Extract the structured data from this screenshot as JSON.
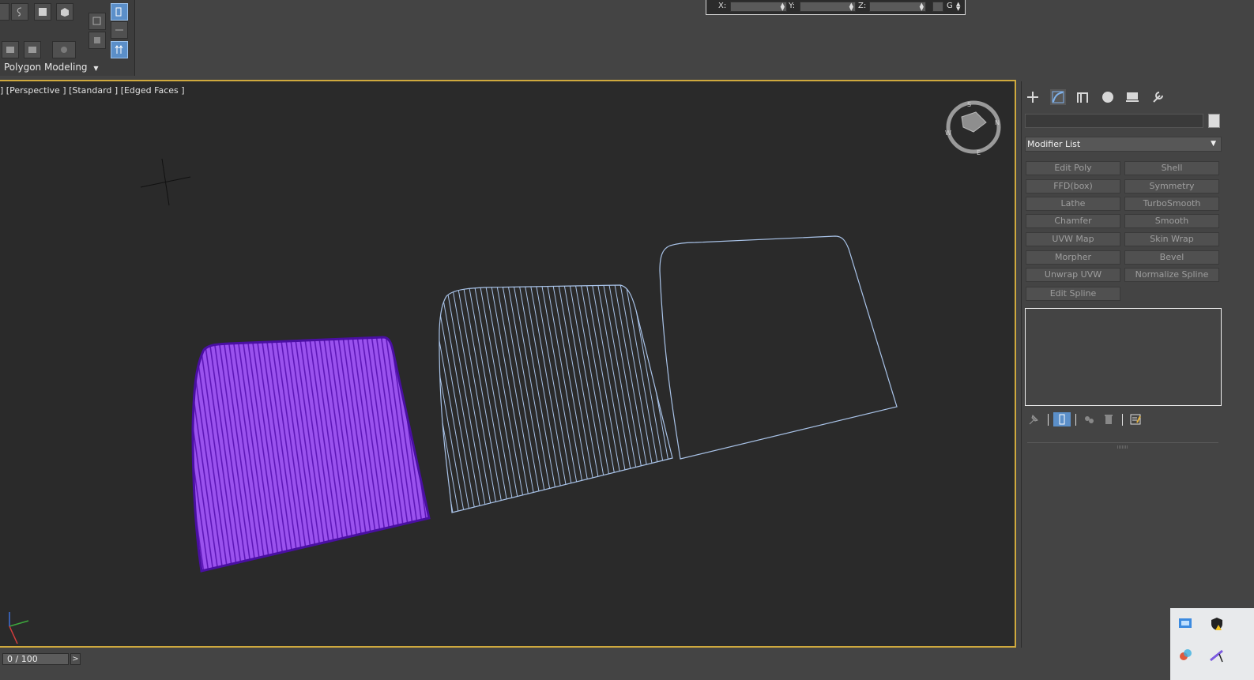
{
  "toolbar": {
    "ribbon_label": "Polygon Modeling",
    "coords": {
      "x_label": "X:",
      "y_label": "Y:",
      "z_label": "Z:",
      "g_label": "G"
    }
  },
  "viewport": {
    "label": "] [Perspective ] [Standard ] [Edged Faces ]",
    "viewcube_labels": [
      "S",
      "W",
      "N",
      "E"
    ],
    "colors": {
      "selected": "#8a3fe0",
      "wire": "#a9c3e8",
      "active_border": "#cfa93e"
    }
  },
  "command_panel": {
    "modifier_list": "Modifier List",
    "modifier_buttons": [
      "Edit Poly",
      "Shell",
      "FFD(box)",
      "Symmetry",
      "Lathe",
      "TurboSmooth",
      "Chamfer",
      "Smooth",
      "UVW Map",
      "Skin Wrap",
      "Morpher",
      "Bevel",
      "Unwrap UVW",
      "Normalize Spline",
      "Edit Spline"
    ],
    "tabs": [
      "create-tab",
      "modify-tab",
      "hierarchy-tab",
      "motion-tab",
      "display-tab",
      "utilities-tab"
    ]
  },
  "timeline": {
    "frame_display": "0 / 100",
    "next_label": ">"
  }
}
